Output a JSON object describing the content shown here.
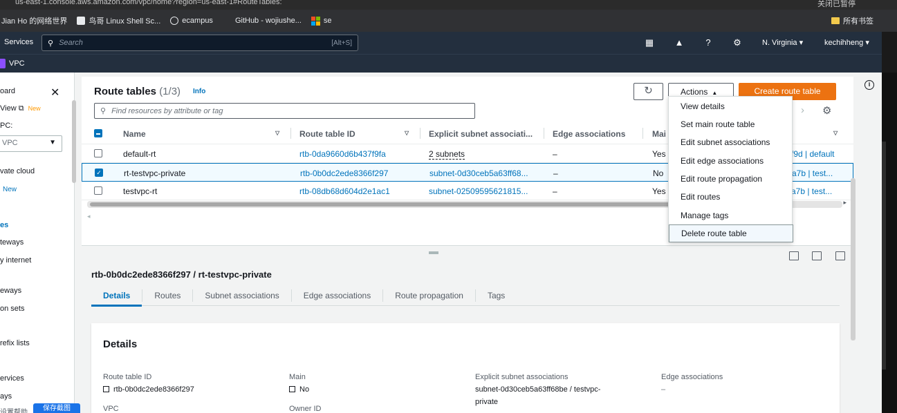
{
  "browser": {
    "url": "us-east-1.console.aws.amazon.com/vpc/home?region=us-east-1#RouteTables:",
    "bookmarks": [
      "Jian Ho 的网络世界",
      "鸟哥 Linux Shell Sc...",
      "ecampus",
      "GitHub - wojiushe...",
      "se"
    ],
    "bookmark_right": "所有书签",
    "profile": "关闭已暂停"
  },
  "aws_nav": {
    "services": "Services",
    "search_placeholder": "Search",
    "search_shortcut": "[Alt+S]",
    "region": "N. Virginia",
    "user": "kechihheng",
    "service_name": "VPC"
  },
  "sidebar": {
    "dashboard": "oard",
    "ec2_global_view": "View",
    "new_badge": "New",
    "filter_label": "PC:",
    "filter_value": "VPC",
    "private_cloud": "vate cloud",
    "new2": "New",
    "route_tables": "es",
    "gateways1": "teways",
    "egress": "y internet",
    "gateways2": "eways",
    "option_sets": "on sets",
    "prefix_lists": "refix lists",
    "services": "ervices",
    "ways": "ays"
  },
  "route_tables": {
    "title": "Route tables",
    "count": "(1/3)",
    "info": "Info",
    "filter_placeholder": "Find resources by attribute or tag",
    "actions_label": "Actions",
    "create_label": "Create route table",
    "columns": [
      "Name",
      "Route table ID",
      "Explicit subnet associati...",
      "Edge associations",
      "Mai"
    ],
    "rows": [
      {
        "name": "default-rt",
        "id": "rtb-0da9660d6b437f9fa",
        "subnets": "2 subnets",
        "edge": "–",
        "main": "Yes",
        "vpc": "f9d | default",
        "selected": false
      },
      {
        "name": "rt-testvpc-private",
        "id": "rtb-0b0dc2ede8366f297",
        "subnets": "subnet-0d30ceb5a63ff68...",
        "edge": "–",
        "main": "No",
        "vpc": "a7b | test...",
        "selected": true
      },
      {
        "name": "testvpc-rt",
        "id": "rtb-08db68d604d2e1ac1",
        "subnets": "subnet-02509595621815...",
        "edge": "–",
        "main": "Yes",
        "vpc": "a7b | test...",
        "selected": false
      }
    ]
  },
  "actions_menu": {
    "items": [
      "View details",
      "Set main route table",
      "Edit subnet associations",
      "Edit edge associations",
      "Edit route propagation",
      "Edit routes",
      "Manage tags",
      "Delete route table"
    ]
  },
  "detail": {
    "title": "rtb-0b0dc2ede8366f297 / rt-testvpc-private",
    "tabs": [
      "Details",
      "Routes",
      "Subnet associations",
      "Edge associations",
      "Route propagation",
      "Tags"
    ],
    "card_title": "Details",
    "route_table_id_label": "Route table ID",
    "route_table_id": "rtb-0b0dc2ede8366f297",
    "main_label": "Main",
    "main": "No",
    "explicit_label": "Explicit subnet associations",
    "explicit_1": "subnet-0d30ceb5a63ff68be / testvpc-",
    "explicit_2": "private",
    "edge_label": "Edge associations",
    "edge": "–",
    "vpc_label": "VPC",
    "owner_label": "Owner ID"
  },
  "bottom": {
    "button": "保存截图",
    "left_frag": "设置帮助"
  },
  "colors": {
    "accent": "#0073bb",
    "create": "#ec7211",
    "nav": "#232f3e"
  }
}
